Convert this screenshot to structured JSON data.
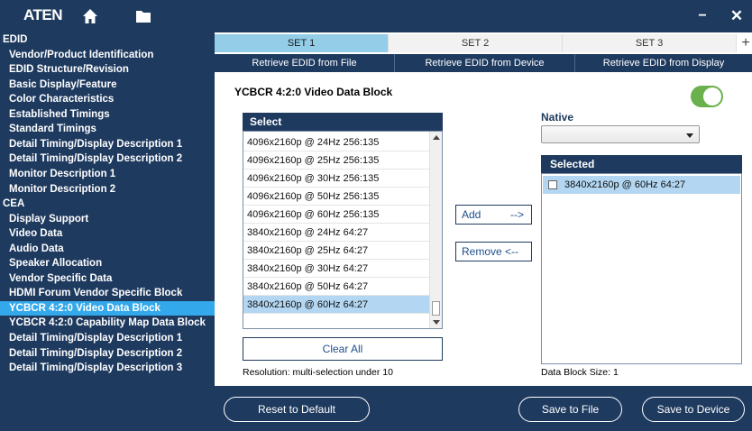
{
  "app": {
    "logo": "ATEN",
    "icons": {
      "home": "home-icon",
      "folder": "folder-icon",
      "minimize": "minimize-icon",
      "close": "close-icon"
    },
    "minimize_glyph": "−",
    "close_glyph": "✕"
  },
  "colors": {
    "navy": "#1e3a5f",
    "active_blue": "#33a8ea",
    "tab_active": "#93cde8",
    "highlight": "#b3d7f2",
    "toggle_on": "#6ab04c"
  },
  "sidebar": {
    "items": [
      {
        "label": "EDID",
        "level": 0
      },
      {
        "label": "Vendor/Product Identification",
        "level": 1
      },
      {
        "label": "EDID Structure/Revision",
        "level": 1
      },
      {
        "label": "Basic Display/Feature",
        "level": 1
      },
      {
        "label": "Color Characteristics",
        "level": 1
      },
      {
        "label": "Established Timings",
        "level": 1
      },
      {
        "label": "Standard Timings",
        "level": 1
      },
      {
        "label": "Detail Timing/Display Description 1",
        "level": 1
      },
      {
        "label": "Detail Timing/Display Description 2",
        "level": 1
      },
      {
        "label": "Monitor Description 1",
        "level": 1
      },
      {
        "label": "Monitor Description 2",
        "level": 1
      },
      {
        "label": "CEA",
        "level": 0
      },
      {
        "label": "Display Support",
        "level": 1
      },
      {
        "label": "Video Data",
        "level": 1
      },
      {
        "label": "Audio Data",
        "level": 1
      },
      {
        "label": "Speaker Allocation",
        "level": 1
      },
      {
        "label": "Vendor Specific Data",
        "level": 1
      },
      {
        "label": "HDMI Forum Vendor Specific Block",
        "level": 1
      },
      {
        "label": "YCBCR 4:2:0 Video Data Block",
        "level": 1,
        "active": true
      },
      {
        "label": "YCBCR 4:2:0 Capability Map Data Block",
        "level": 1
      },
      {
        "label": "Detail Timing/Display Description 1",
        "level": 1
      },
      {
        "label": "Detail Timing/Display Description 2",
        "level": 1
      },
      {
        "label": "Detail Timing/Display Description 3",
        "level": 1
      }
    ]
  },
  "tabs": [
    {
      "label": "SET 1",
      "active": true
    },
    {
      "label": "SET 2",
      "active": false
    },
    {
      "label": "SET 3",
      "active": false
    }
  ],
  "tab_add": "+",
  "retrieve": [
    "Retrieve EDID from File",
    "Retrieve EDID from Device",
    "Retrieve EDID from Display"
  ],
  "main": {
    "title": "YCBCR 4:2:0 Video Data Block",
    "toggle_on": true,
    "select_header": "Select",
    "select_items": [
      "4096x2160p @ 24Hz 256:135",
      "4096x2160p @ 25Hz 256:135",
      "4096x2160p @ 30Hz 256:135",
      "4096x2160p @ 50Hz 256:135",
      "4096x2160p @ 60Hz 256:135",
      "3840x2160p @ 24Hz 64:27",
      "3840x2160p @ 25Hz 64:27",
      "3840x2160p @ 30Hz 64:27",
      "3840x2160p @ 50Hz 64:27",
      "3840x2160p @ 60Hz 64:27"
    ],
    "highlighted_index": 9,
    "clear_all": "Clear All",
    "resolution_note": "Resolution: multi-selection under 10",
    "add_label": "Add",
    "add_arrow": "-->",
    "remove_label": "Remove <--",
    "native_label": "Native",
    "native_value": "",
    "selected_header": "Selected",
    "selected_items": [
      "3840x2160p @ 60Hz 64:27"
    ],
    "block_size": "Data Block Size:  1"
  },
  "bottom": {
    "reset": "Reset to Default",
    "save_file": "Save to File",
    "save_device": "Save to Device"
  }
}
